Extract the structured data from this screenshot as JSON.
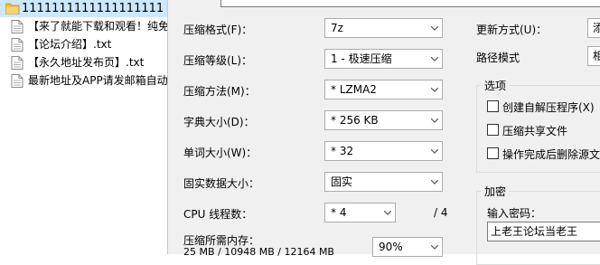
{
  "file_list": {
    "folder": {
      "name": "1111111111111111111"
    },
    "files": [
      {
        "name": "【来了就能下载和观看！纯免"
      },
      {
        "name": "【论坛介绍】.txt"
      },
      {
        "name": "【永久地址发布页】.txt"
      },
      {
        "name": "最新地址及APP请发邮箱自动"
      }
    ]
  },
  "dialog": {
    "format": {
      "label": "压缩格式(F)：",
      "value": "7z"
    },
    "level": {
      "label": "压缩等级(L)：",
      "value": "1 - 极速压缩"
    },
    "method": {
      "label": "压缩方法(M)：",
      "value": "* LZMA2"
    },
    "dict": {
      "label": "字典大小(D)：",
      "value": "* 256 KB"
    },
    "word": {
      "label": "单词大小(W)：",
      "value": "* 32"
    },
    "solid": {
      "label": "固实数据大小：",
      "value": "固实"
    },
    "threads": {
      "label": "CPU 线程数：",
      "value": "* 4",
      "max": "/ 4"
    },
    "memory": {
      "label": "压缩所需内存：",
      "detail": "25 MB / 10948 MB / 12164 MB",
      "percent": "90%"
    },
    "update_mode": {
      "label": "更新方式(U)：",
      "value": "添"
    },
    "path_mode": {
      "label": "路径模式",
      "value": "相"
    },
    "options": {
      "title": "选项",
      "items": [
        {
          "label": "创建自解压程序(X)",
          "checked": false
        },
        {
          "label": "压缩共享文件",
          "checked": false
        },
        {
          "label": "操作完成后删除源文",
          "checked": false
        }
      ]
    },
    "encryption": {
      "title": "加密",
      "password_label": "输入密码：",
      "password_value": "上老王论坛当老王"
    }
  }
}
